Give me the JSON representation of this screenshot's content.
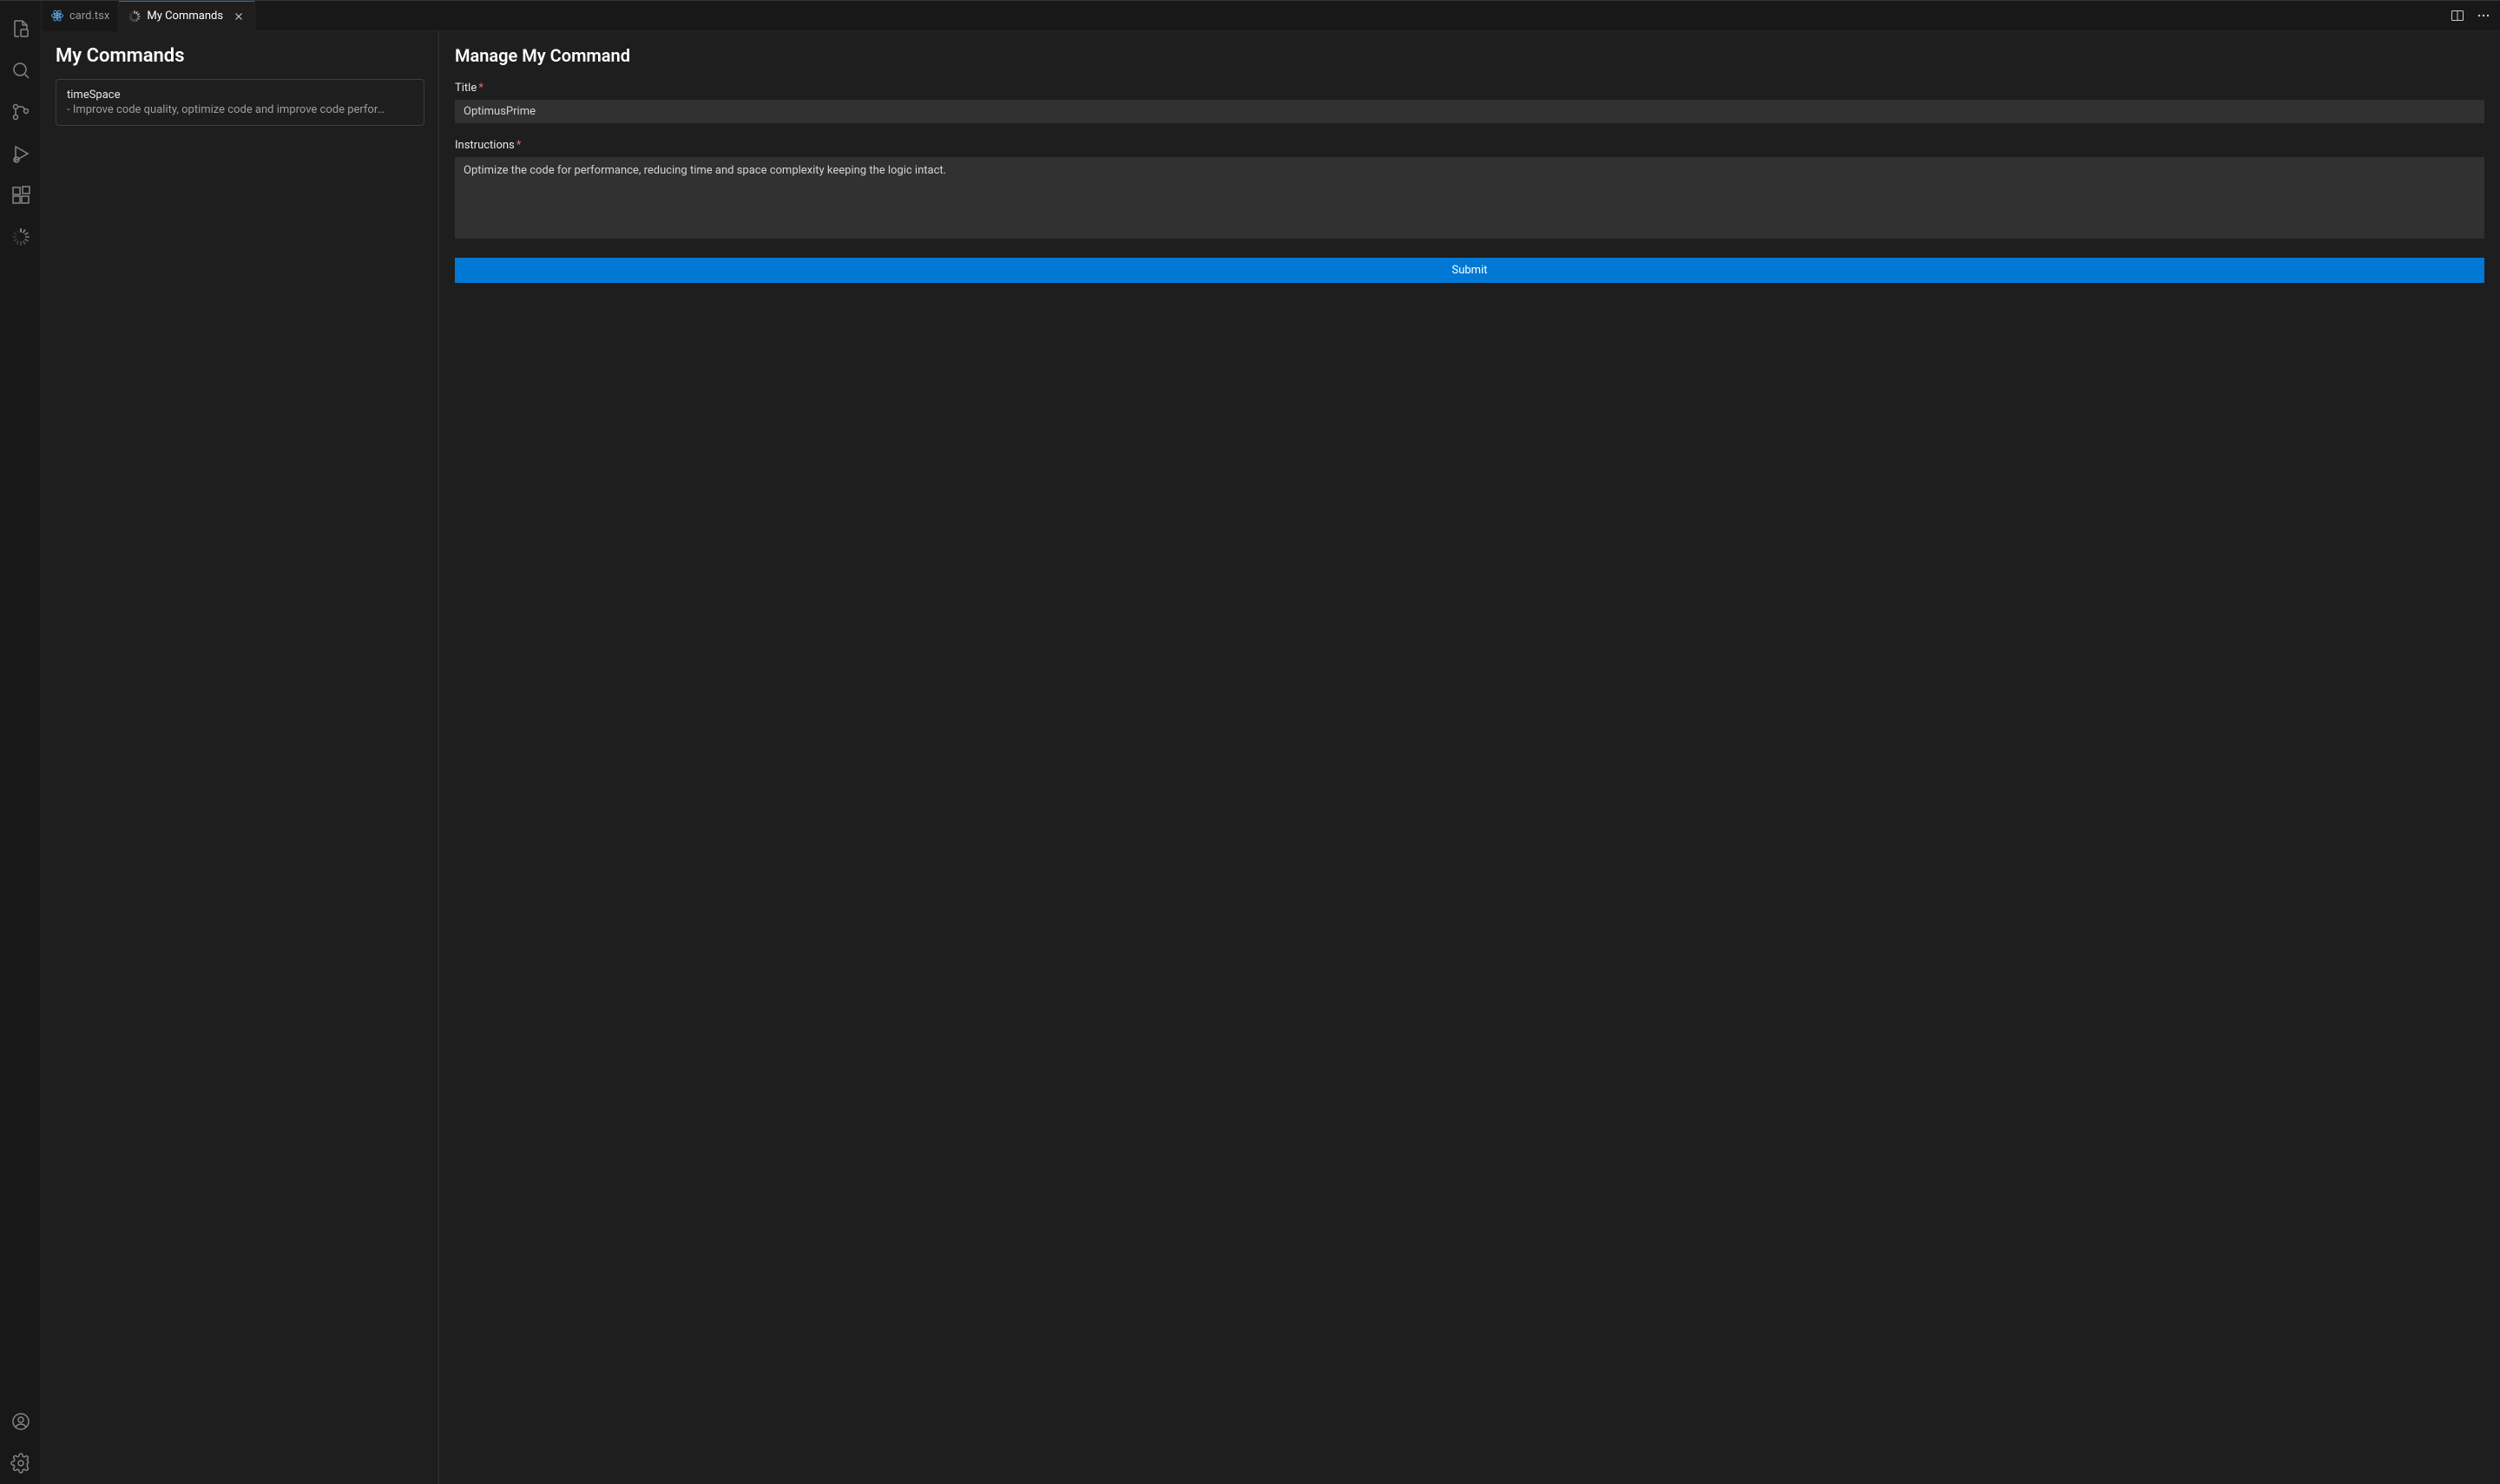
{
  "tabs": [
    {
      "label": "card.tsx"
    },
    {
      "label": "My Commands"
    }
  ],
  "left": {
    "heading": "My Commands",
    "commands": [
      {
        "title": "timeSpace",
        "desc": "- Improve code quality, optimize code and improve code perfor…"
      }
    ]
  },
  "form": {
    "heading": "Manage My Command",
    "title_label": "Title",
    "title_value": "OptimusPrime",
    "instructions_label": "Instructions",
    "instructions_value": "Optimize the code for performance, reducing time and space complexity keeping the logic intact.",
    "submit_label": "Submit"
  }
}
